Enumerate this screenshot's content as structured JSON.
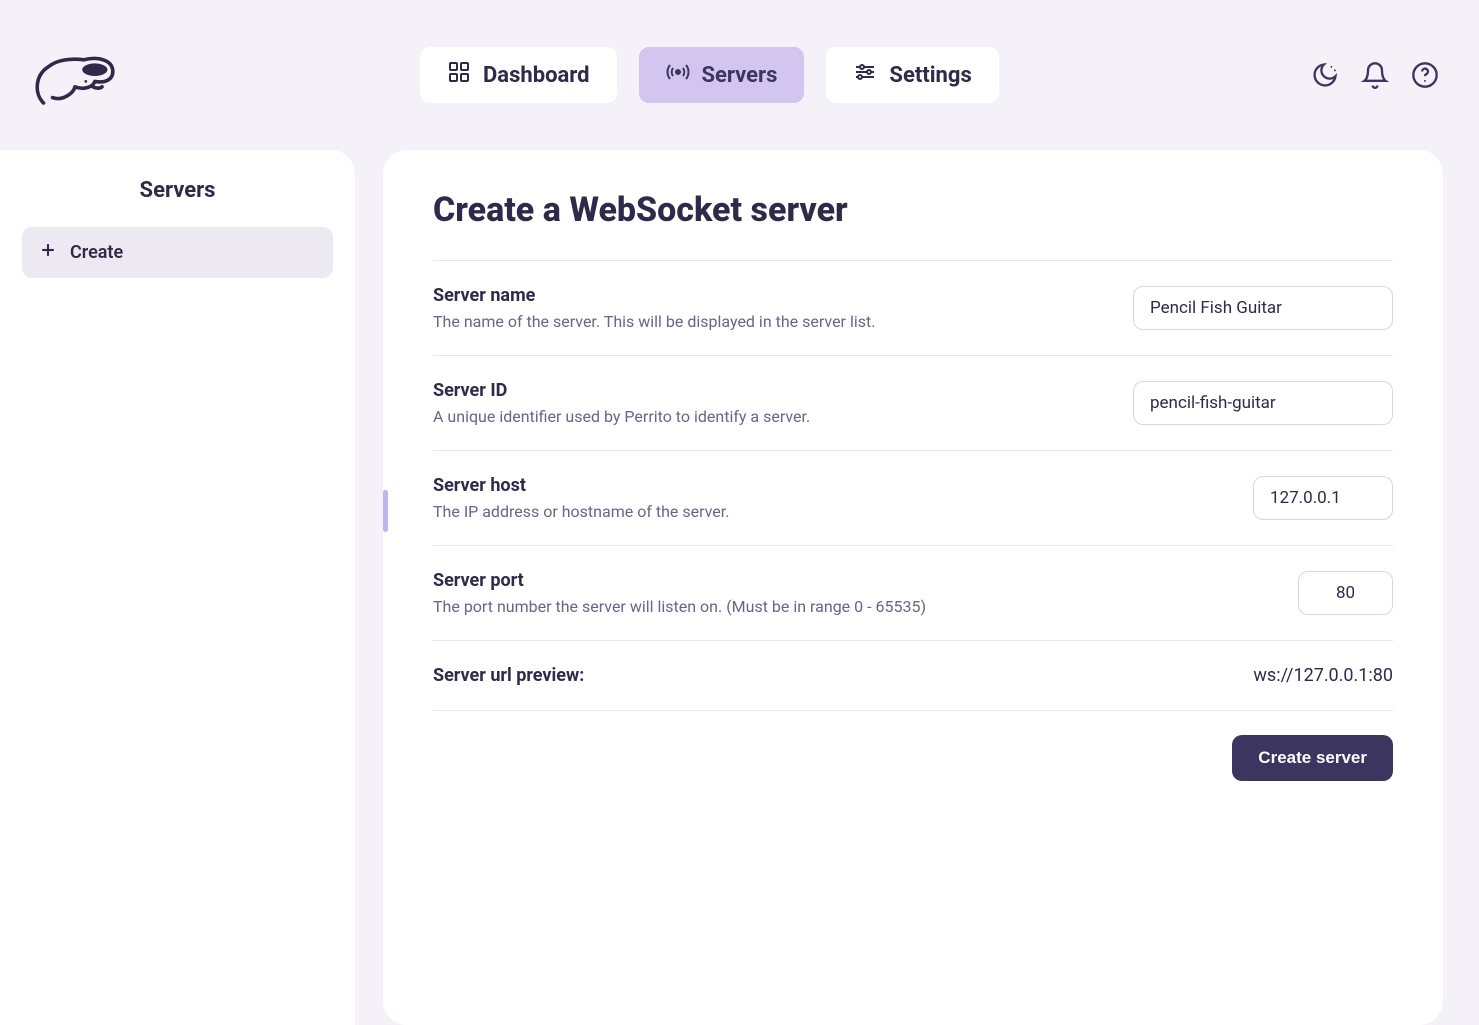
{
  "nav": {
    "dashboard": "Dashboard",
    "servers": "Servers",
    "settings": "Settings"
  },
  "sidebar": {
    "title": "Servers",
    "create": "Create"
  },
  "page": {
    "title": "Create a WebSocket server"
  },
  "fields": {
    "name": {
      "label": "Server name",
      "desc": "The name of the server. This will be displayed in the server list.",
      "value": "Pencil Fish Guitar"
    },
    "id": {
      "label": "Server ID",
      "desc": "A unique identifier used by Perrito to identify a server.",
      "value": "pencil-fish-guitar"
    },
    "host": {
      "label": "Server host",
      "desc": "The IP address or hostname of the server.",
      "value": "127.0.0.1"
    },
    "port": {
      "label": "Server port",
      "desc": "The port number the server will listen on. (Must be in range 0 - 65535)",
      "value": "80"
    }
  },
  "preview": {
    "label": "Server url preview:",
    "value": "ws://127.0.0.1:80"
  },
  "actions": {
    "create": "Create server"
  }
}
